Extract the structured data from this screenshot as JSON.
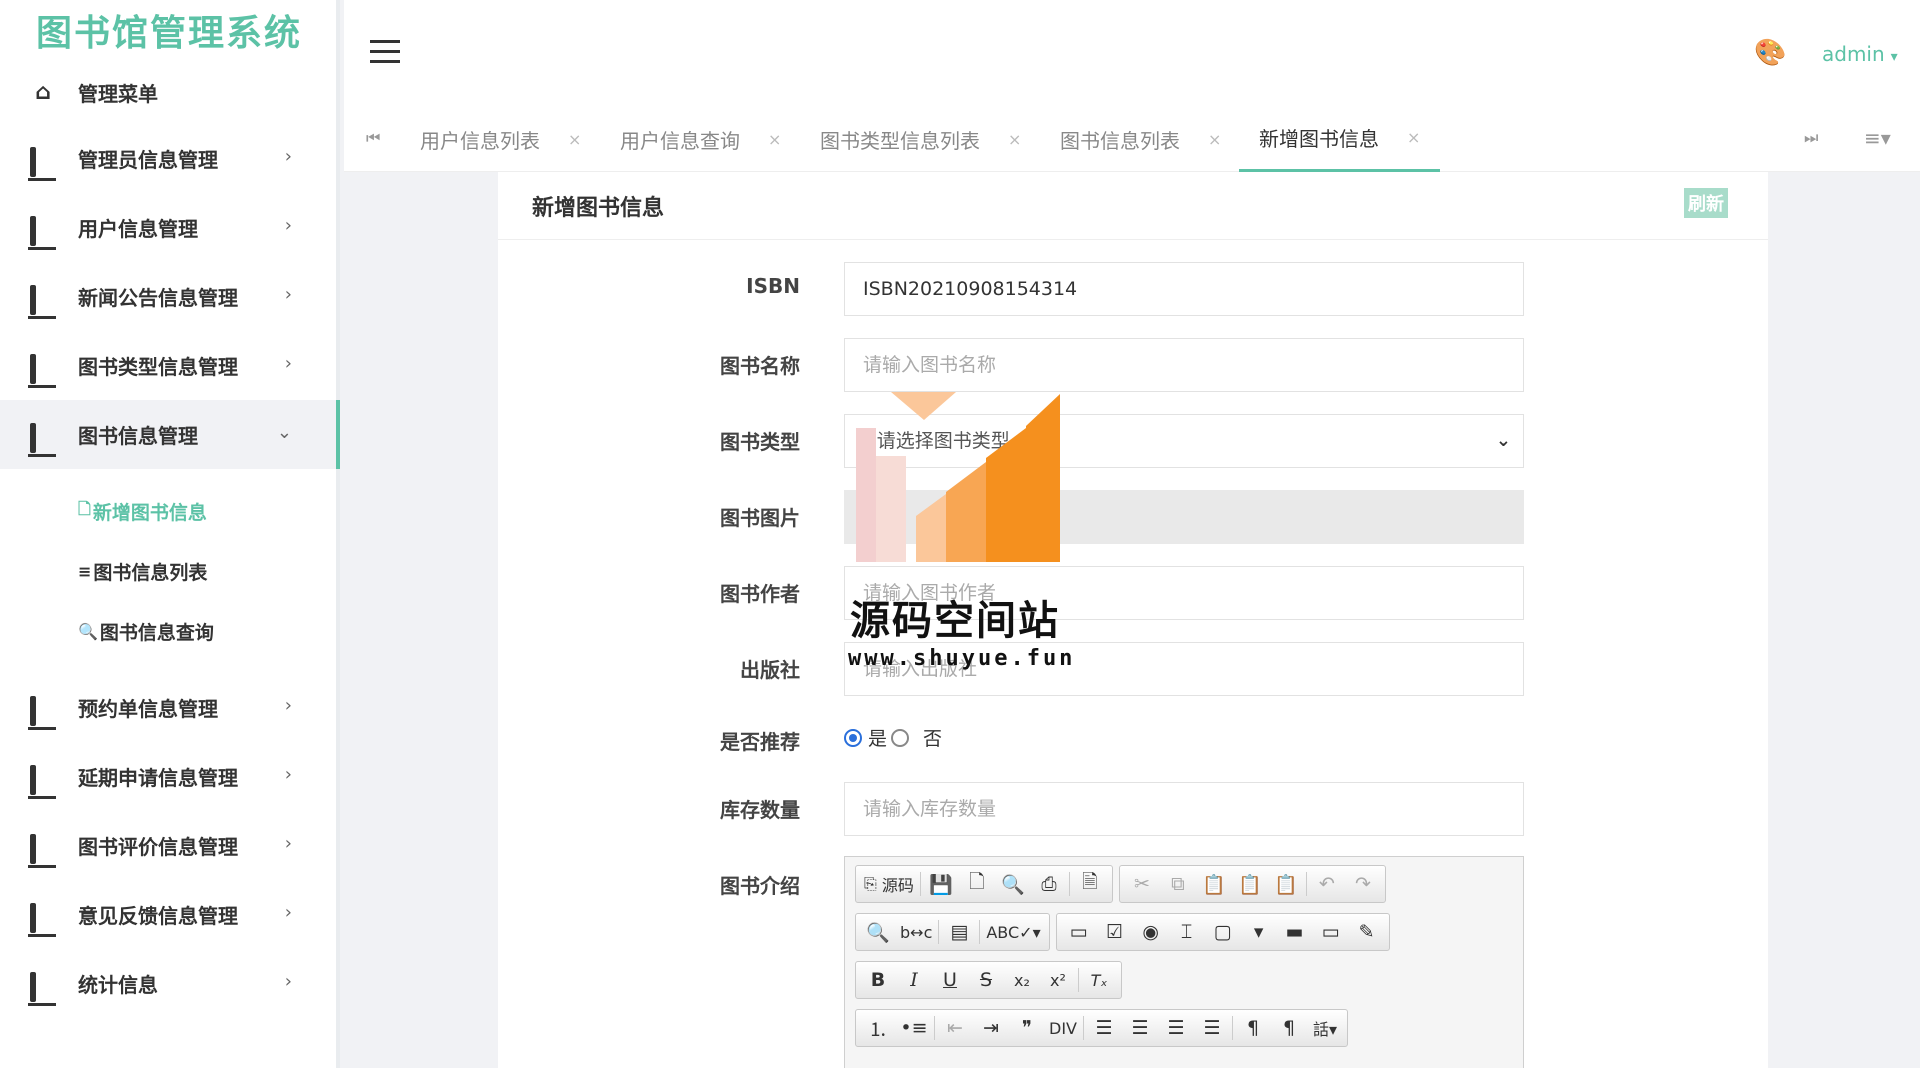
{
  "app": {
    "title": "图书馆管理系统"
  },
  "sidebar": {
    "header": "管理菜单",
    "items": [
      {
        "label": "管理员信息管理"
      },
      {
        "label": "用户信息管理"
      },
      {
        "label": "新闻公告信息管理"
      },
      {
        "label": "图书类型信息管理"
      },
      {
        "label": "图书信息管理"
      },
      {
        "label": "预约单信息管理"
      },
      {
        "label": "延期申请信息管理"
      },
      {
        "label": "图书评价信息管理"
      },
      {
        "label": "意见反馈信息管理"
      },
      {
        "label": "统计信息"
      }
    ],
    "submenu": [
      {
        "icon": "🗋",
        "label": "新增图书信息"
      },
      {
        "icon": "≡",
        "label": "图书信息列表"
      },
      {
        "icon": "🔍",
        "label": "图书信息查询"
      }
    ]
  },
  "header": {
    "user": "admin"
  },
  "tabs": [
    {
      "label": "用户信息列表"
    },
    {
      "label": "用户信息查询"
    },
    {
      "label": "图书类型信息列表"
    },
    {
      "label": "图书信息列表"
    },
    {
      "label": "新增图书信息"
    }
  ],
  "content": {
    "title": "新增图书信息",
    "refresh_label": "刷新"
  },
  "form": {
    "isbn": {
      "label": "ISBN",
      "value": "ISBN20210908154314"
    },
    "name": {
      "label": "图书名称",
      "placeholder": "请输入图书名称"
    },
    "type": {
      "label": "图书类型",
      "value": "--请选择图书类型--"
    },
    "image": {
      "label": "图书图片"
    },
    "author": {
      "label": "图书作者",
      "placeholder": "请输入图书作者"
    },
    "publisher": {
      "label": "出版社",
      "placeholder": "请输入出版社"
    },
    "recommend": {
      "label": "是否推荐",
      "yes": "是",
      "no": "否",
      "selected": "是"
    },
    "stock": {
      "label": "库存数量",
      "placeholder": "请输入库存数量"
    },
    "intro": {
      "label": "图书介绍",
      "source_label": "源码"
    }
  },
  "watermark": {
    "title": "源码空间站",
    "url": "www.shuyue.fun",
    "colors": {
      "orange": "#f5901e",
      "light": "#fbc79a",
      "pink": "#f3cfcf"
    }
  },
  "colors": {
    "accent": "#5cc2a6"
  }
}
